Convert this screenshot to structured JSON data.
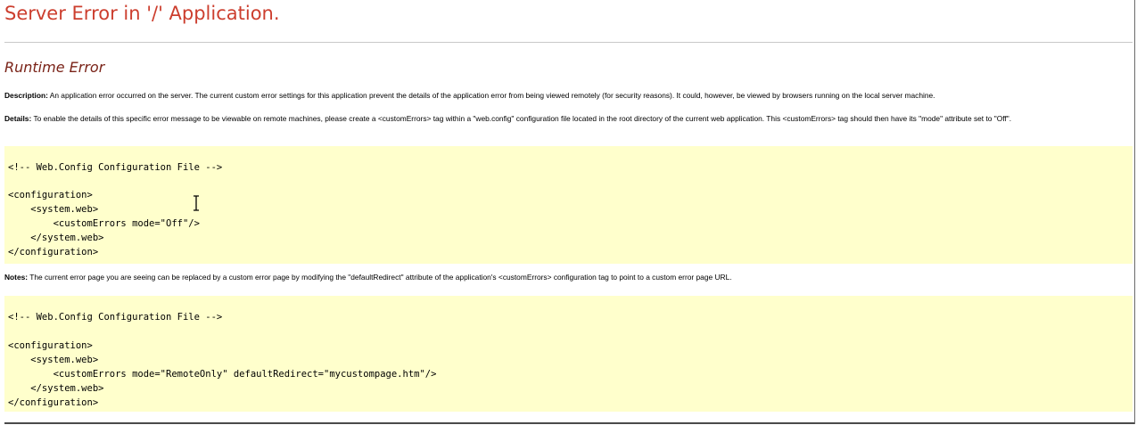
{
  "page_title": "Server Error in '/' Application.",
  "error_type": "Runtime Error",
  "description": {
    "label": "Description:",
    "text": " An application error occurred on the server. The current custom error settings for this application prevent the details of the application error from being viewed remotely (for security reasons). It could, however, be viewed by browsers running on the local server machine."
  },
  "details": {
    "label": "Details:",
    "text": " To enable the details of this specific error message to be viewable on remote machines, please create a <customErrors> tag within a \"web.config\" configuration file located in the root directory of the current web application. This <customErrors> tag should then have its \"mode\" attribute set to \"Off\"."
  },
  "code_block_1": {
    "lines": [
      "<!-- Web.Config Configuration File -->",
      "",
      "<configuration>",
      "    <system.web>",
      "        <customErrors mode=\"Off\"/>",
      "    </system.web>",
      "</configuration>"
    ]
  },
  "notes": {
    "label": "Notes:",
    "text": " The current error page you are seeing can be replaced by a custom error page by modifying the \"defaultRedirect\" attribute of the application's <customErrors> configuration tag to point to a custom error page URL."
  },
  "code_block_2": {
    "lines": [
      "<!-- Web.Config Configuration File -->",
      "",
      "<configuration>",
      "    <system.web>",
      "        <customErrors mode=\"RemoteOnly\" defaultRedirect=\"mycustompage.htm\"/>",
      "    </system.web>",
      "</configuration>"
    ]
  },
  "colors": {
    "title": "#cc3e2e",
    "subtitle": "#7a2318",
    "code_background": "#ffffcc"
  },
  "icons": {
    "cursor": "text-cursor-icon"
  }
}
